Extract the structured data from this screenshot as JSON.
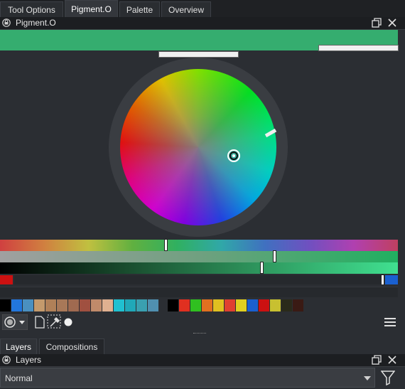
{
  "tabs": [
    {
      "label": "Tool Options",
      "active": false
    },
    {
      "label": "Pigment.O",
      "active": true
    },
    {
      "label": "Palette",
      "active": false
    },
    {
      "label": "Overview",
      "active": false
    }
  ],
  "panel": {
    "title": "Pigment.O",
    "current_color": "#35ad6f",
    "hue_slider_value": 0.41,
    "saturation_slider_value": 0.69,
    "value_slider_value": 0.66
  },
  "swatches": [
    "#000000",
    "#2277dd",
    "#4a90c0",
    "#c49a6c",
    "#b08058",
    "#a87858",
    "#a06a50",
    "#a05040",
    "#c08a6a",
    "#e0b090",
    "#20c0d0",
    "#20a8b8",
    "#3aa0b0",
    "#5090b0",
    "#000000",
    "#e03020",
    "#30c020",
    "#e07020",
    "#e0c020",
    "#e04030",
    "#e0d020",
    "#1a60d0",
    "#cc1111",
    "#c8c030",
    "#2a2a1a",
    "#3a1a14"
  ],
  "bottom_tabs": [
    {
      "label": "Layers",
      "active": true
    },
    {
      "label": "Compositions",
      "active": false
    }
  ],
  "layers": {
    "title": "Layers",
    "blend_mode": "Normal"
  }
}
